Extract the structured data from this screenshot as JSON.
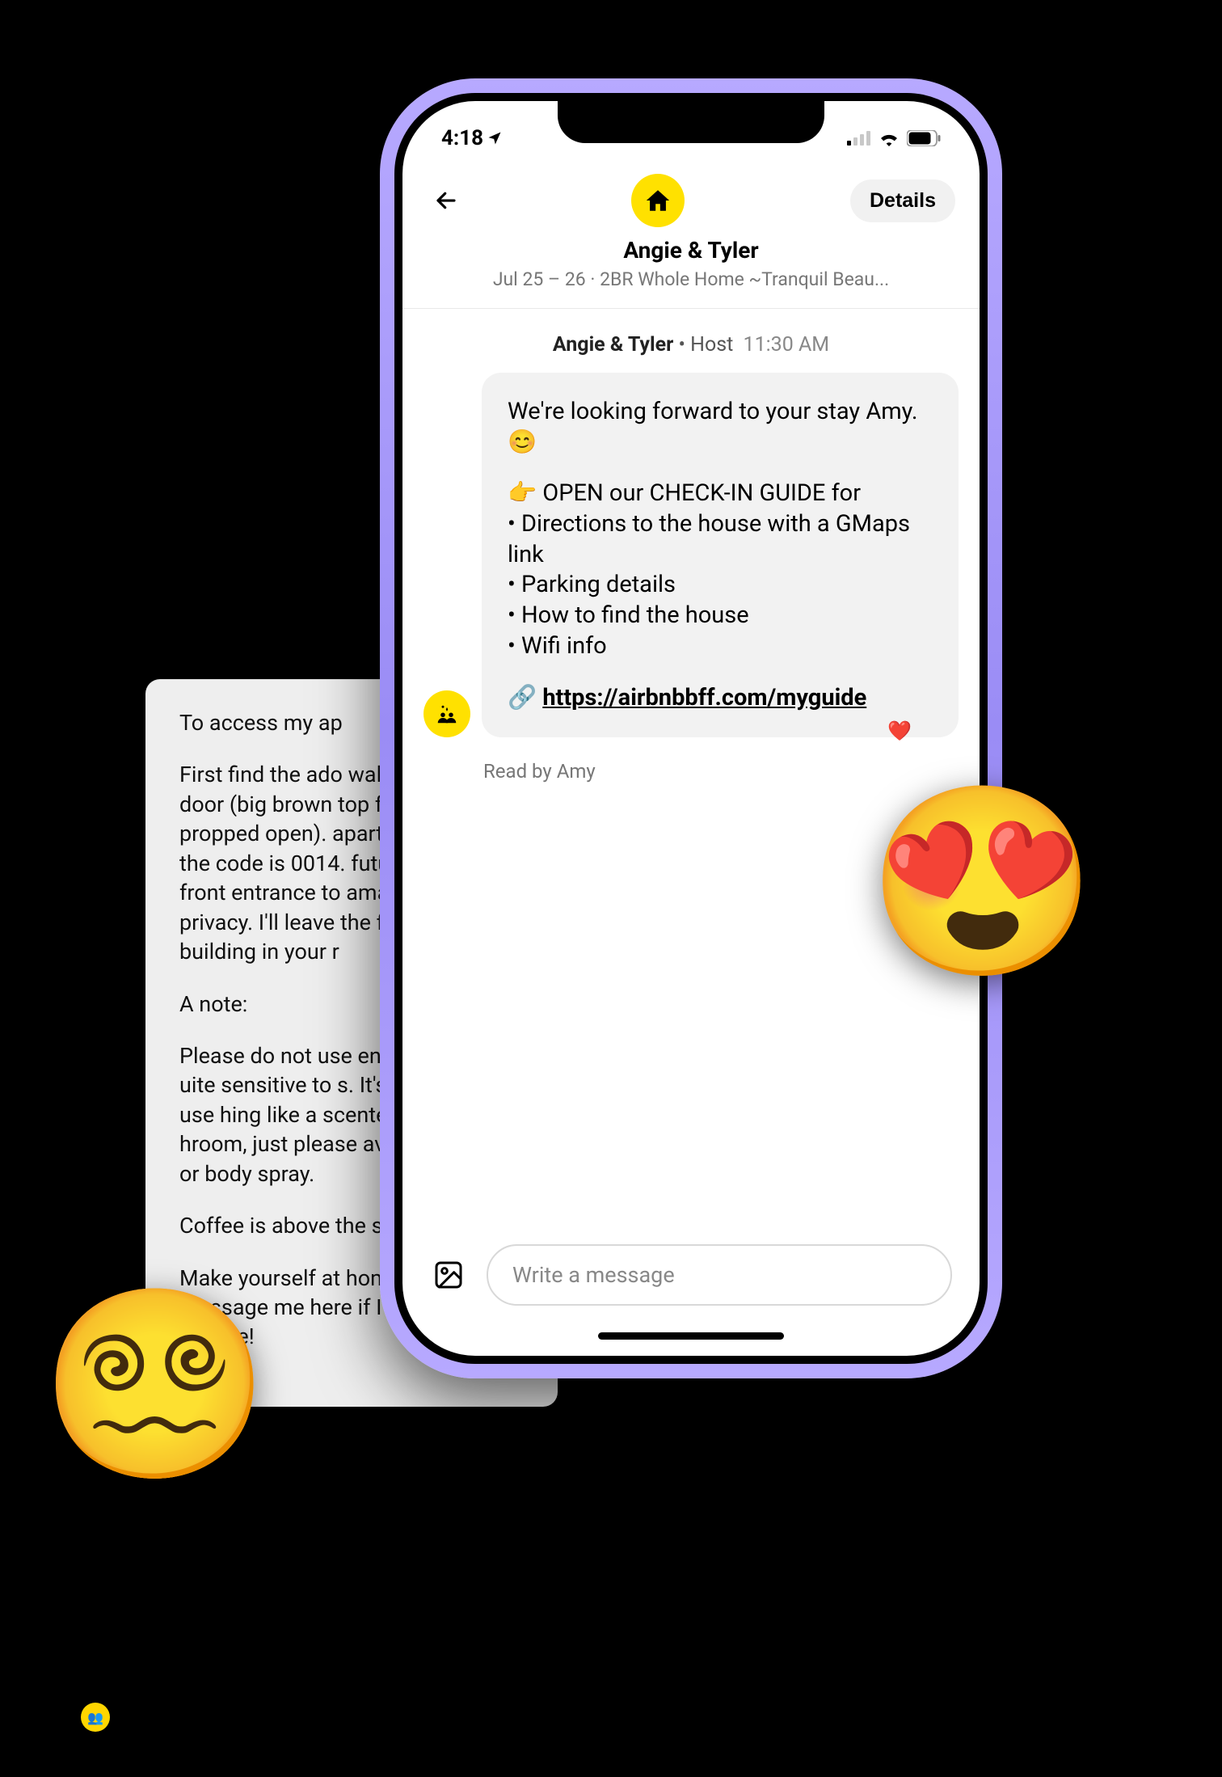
{
  "bg_card": {
    "p1": "To access my ap",
    "p2": "First find the ado walk around to th door (big brown top floor, building propped open). apartment #1 has the code is 0014. future, please on front entrance to amazing neighbo privacy. I'll leave the front door of building in your r",
    "p3_pre": "A note:",
    "p3": "Please do not use ents during you uite sensitive to s. It's totally ok to use hing like a scented roduct in the hroom, just please avoid perfumes or body spray.",
    "p4": "Coffee is above the stove!",
    "p5": "Make yourself at home, and message me here if I can be of service!"
  },
  "status": {
    "time": "4:18",
    "location_icon": "▶",
    "battery_pct": ""
  },
  "header": {
    "details_label": "Details",
    "title": "Angie & Tyler",
    "subtitle": "Jul 25 – 26 · 2BR Whole Home ~Tranquil Beau..."
  },
  "message": {
    "sender": "Angie & Tyler",
    "role": "Host",
    "time": "11:30 AM",
    "line1": "We're looking forward to your stay Amy. 😊",
    "line2": "👉 OPEN our CHECK-IN GUIDE for",
    "bullet1": "• Directions to the house with a GMaps link",
    "bullet2": "• Parking details",
    "bullet3": "• How to find the house",
    "bullet4": "• Wifi info",
    "link_prefix": "🔗 ",
    "link_text": "https://airbnbbff.com/myguide",
    "reaction": "❤️",
    "read_receipt": "Read by Amy"
  },
  "input": {
    "placeholder": "Write a message"
  },
  "overlays": {
    "heart_eyes": "😍",
    "dizzy": "😵‍💫"
  },
  "icons": {
    "house": "🏠",
    "host_avatar": "👥"
  }
}
